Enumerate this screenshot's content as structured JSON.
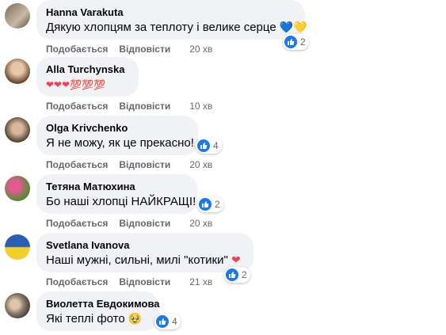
{
  "colors": {
    "bubble": "#f0f2f5",
    "secondary_text": "#65676b",
    "like_blue": "#1877f2"
  },
  "comments": [
    {
      "author": "Hanna Varakuta",
      "text": "Дякую хлопцям за теплоту і велике серце",
      "emoji": "💙💛",
      "like_label": "Подобається",
      "reply_label": "Відповісти",
      "time": "20 хв",
      "reaction_count": "2"
    },
    {
      "author": "Alla Turchynska",
      "text": "",
      "emoji": "❤❤❤💯💯💯",
      "like_label": "Подобається",
      "reply_label": "Відповісти",
      "time": "10 хв",
      "reaction_count": ""
    },
    {
      "author": "Olga Krivchenko",
      "text": "Я не можу, як це прекасно!",
      "emoji": "",
      "like_label": "Подобається",
      "reply_label": "Відповісти",
      "time": "20 хв",
      "reaction_count": "4"
    },
    {
      "author": "Тетяна Матюхина",
      "text": "Бо наші хлопці НАЙКРАЩІ!",
      "emoji": "",
      "like_label": "Подобається",
      "reply_label": "Відповісти",
      "time": "20 хв",
      "reaction_count": "2"
    },
    {
      "author": "Svetlana Ivanova",
      "text": "Наші мужні, сильні, милі \"котики\"",
      "emoji": "❤",
      "like_label": "Подобається",
      "reply_label": "Відповісти",
      "time": "21 хв",
      "reaction_count": "2"
    },
    {
      "author": "Виолетта Евдокимова",
      "text": "Які теплі фото",
      "emoji": "🥹",
      "like_label": "",
      "reply_label": "",
      "time": "",
      "reaction_count": "4"
    }
  ]
}
